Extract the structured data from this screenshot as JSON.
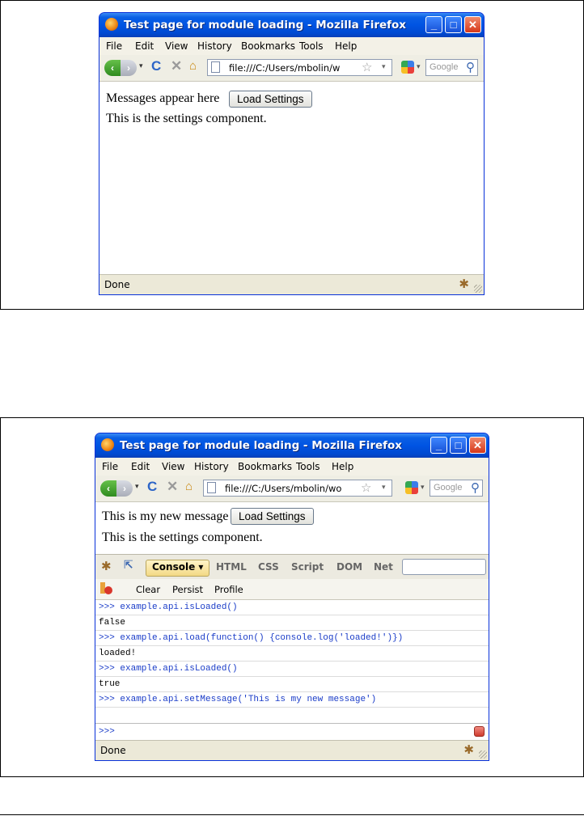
{
  "window": {
    "title": "Test page for module loading - Mozilla Firefox",
    "minimize_glyph": "_",
    "maximize_glyph": "□",
    "close_glyph": "✕"
  },
  "menu": [
    "File",
    "Edit",
    "View",
    "History",
    "Bookmarks",
    "Tools",
    "Help"
  ],
  "nav": {
    "back_glyph": "‹",
    "forward_glyph": "›",
    "dropdown_glyph": "▾",
    "reload_glyph": "C",
    "stop_glyph": "✕",
    "home_glyph": "⌂",
    "star_glyph": "☆",
    "magnifier_glyph": "⚲",
    "search_placeholder": "Google"
  },
  "screenshot1": {
    "url": "file:///C:/Users/mbolin/w",
    "message": "Messages appear here",
    "button_label": "Load Settings",
    "settings_text": "This is the settings component.",
    "status": "Done"
  },
  "screenshot2": {
    "url": "file:///C:/Users/mbolin/wo",
    "message": "This is my new message",
    "button_label": "Load Settings",
    "settings_text": "This is the settings component.",
    "status": "Done",
    "firebug": {
      "tabs": {
        "console": "Console ▾",
        "html": "HTML",
        "css": "CSS",
        "script": "Script",
        "dom": "DOM",
        "net": "Net"
      },
      "actions": {
        "clear": "Clear",
        "persist": "Persist",
        "profile": "Profile"
      },
      "lines": [
        ">>> example.api.isLoaded()",
        "false",
        ">>> example.api.load(function() {console.log('loaded!')})",
        "loaded!",
        ">>> example.api.isLoaded()",
        "true",
        ">>> example.api.setMessage('This is my new message')"
      ],
      "prompt": ">>>"
    }
  },
  "icons": {
    "firefox": "firefox-logo-icon",
    "bug": "firebug-icon",
    "inspect": "inspect-cursor-icon",
    "page": "page-icon",
    "search_engine": "google-icon",
    "clear": "clear-console-icon",
    "close": "close-icon"
  }
}
